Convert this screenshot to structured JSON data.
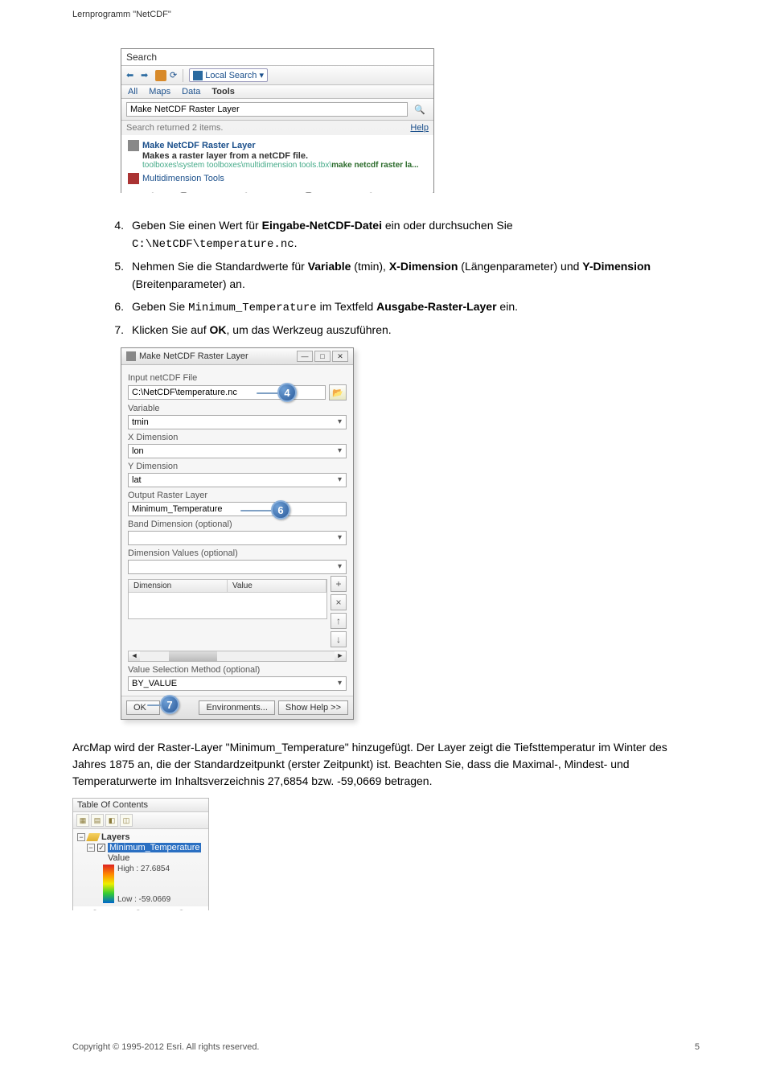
{
  "page_header": "Lernprogramm \"NetCDF\"",
  "search_panel": {
    "title": "Search",
    "local_search": "Local Search",
    "tabs": [
      "All",
      "Maps",
      "Data",
      "Tools"
    ],
    "query": "Make NetCDF Raster Layer",
    "status": "Search returned 2 items.",
    "help": "Help",
    "item1_title": "Make NetCDF Raster Layer",
    "item1_sub_pre": "Makes a raster layer",
    "item1_sub_post": " from a netCDF file.",
    "item1_path_pre": "toolboxes\\system toolboxes\\multidimension tools.tbx\\",
    "item1_path_bold": "make netcdf raster la...",
    "item2": "Multidimension Tools"
  },
  "steps": {
    "s4": {
      "num": "4.",
      "pre": "Geben Sie einen Wert für ",
      "b1": "Eingabe-NetCDF-Datei",
      "mid": " ein oder durchsuchen Sie ",
      "code": "C:\\NetCDF\\temperature.nc",
      "post": "."
    },
    "s5": {
      "num": "5.",
      "pre": "Nehmen Sie die Standardwerte für ",
      "b1": "Variable",
      "mid1": " (tmin), ",
      "b2": "X-Dimension",
      "mid2": " (Längenparameter) und ",
      "b3": "Y-Dimension",
      "post": " (Breitenparameter) an."
    },
    "s6": {
      "num": "6.",
      "pre": "Geben Sie ",
      "code": "Minimum_Temperature",
      "mid": " im Textfeld ",
      "b1": "Ausgabe-Raster-Layer",
      "post": " ein."
    },
    "s7": {
      "num": "7.",
      "pre": "Klicken Sie auf ",
      "b1": "OK",
      "post": ", um das Werkzeug auszuführen."
    }
  },
  "dialog": {
    "title": "Make NetCDF Raster Layer",
    "labels": {
      "input": "Input netCDF File",
      "variable": "Variable",
      "xdim": "X Dimension",
      "ydim": "Y Dimension",
      "output": "Output Raster Layer",
      "band": "Band Dimension (optional)",
      "dimvals": "Dimension Values (optional)",
      "th_dim": "Dimension",
      "th_val": "Value",
      "valsel": "Value Selection Method (optional)"
    },
    "values": {
      "input": "C:\\NetCDF\\temperature.nc",
      "variable": "tmin",
      "xdim": "lon",
      "ydim": "lat",
      "output": "Minimum_Temperature",
      "band": "",
      "byvalue": "BY_VALUE"
    },
    "badges": {
      "b4": "4",
      "b6": "6",
      "b7": "7"
    },
    "buttons": {
      "ok": "OK",
      "env": "Environments...",
      "help": "Show Help >>"
    }
  },
  "paragraph": "ArcMap wird der Raster-Layer \"Minimum_Temperature\" hinzugefügt. Der Layer zeigt die Tiefsttemperatur im Winter des Jahres 1875 an, die der Standardzeitpunkt (erster Zeitpunkt) ist. Beachten Sie, dass die Maximal-, Mindest- und Temperaturwerte im Inhaltsverzeichnis 27,6854 bzw. -59,0669 betragen.",
  "toc": {
    "title": "Table Of Contents",
    "layers": "Layers",
    "layer_name": "Minimum_Temperature",
    "value": "Value",
    "high": "High : 27.6854",
    "low": "Low : -59.0669"
  },
  "footer": {
    "copyright": "Copyright © 1995-2012 Esri. All rights reserved.",
    "page": "5"
  },
  "chart_data": {
    "type": "table",
    "title": "NetCDF Raster Layer statistics",
    "series": [
      {
        "name": "High",
        "values": [
          27.6854
        ]
      },
      {
        "name": "Low",
        "values": [
          -59.0669
        ]
      }
    ]
  }
}
